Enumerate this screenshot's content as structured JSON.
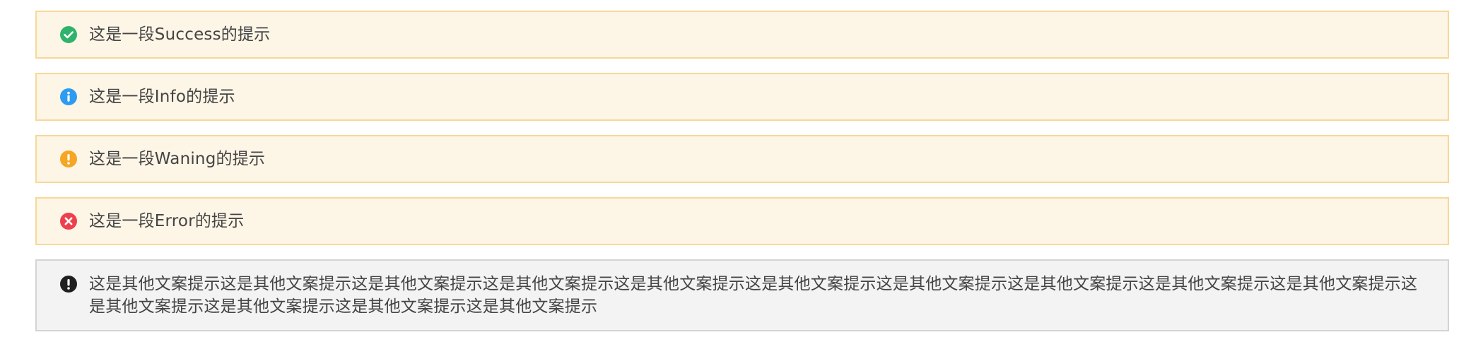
{
  "alerts": [
    {
      "type": "success",
      "text": "这是一段Success的提示",
      "icon": "check-circle-icon",
      "color": "#2fb36b"
    },
    {
      "type": "info",
      "text": "这是一段Info的提示",
      "icon": "info-circle-icon",
      "color": "#2d9bf0"
    },
    {
      "type": "warning",
      "text": "这是一段Waning的提示",
      "icon": "exclamation-circle-icon",
      "color": "#f5a623"
    },
    {
      "type": "error",
      "text": "这是一段Error的提示",
      "icon": "close-circle-icon",
      "color": "#ee3f4d"
    }
  ],
  "note": {
    "type": "other",
    "text": "这是其他文案提示这是其他文案提示这是其他文案提示这是其他文案提示这是其他文案提示这是其他文案提示这是其他文案提示这是其他文案提示这是其他文案提示这是其他文案提示这是其他文案提示这是其他文案提示这是其他文案提示这是其他文案提示",
    "icon": "exclamation-circle-icon",
    "color": "#1f1f1f"
  },
  "theme": {
    "tip_background": "#fdf5e6",
    "tip_border": "#f7d898",
    "note_background": "#f3f3f3",
    "note_border": "#d4d4d4"
  }
}
